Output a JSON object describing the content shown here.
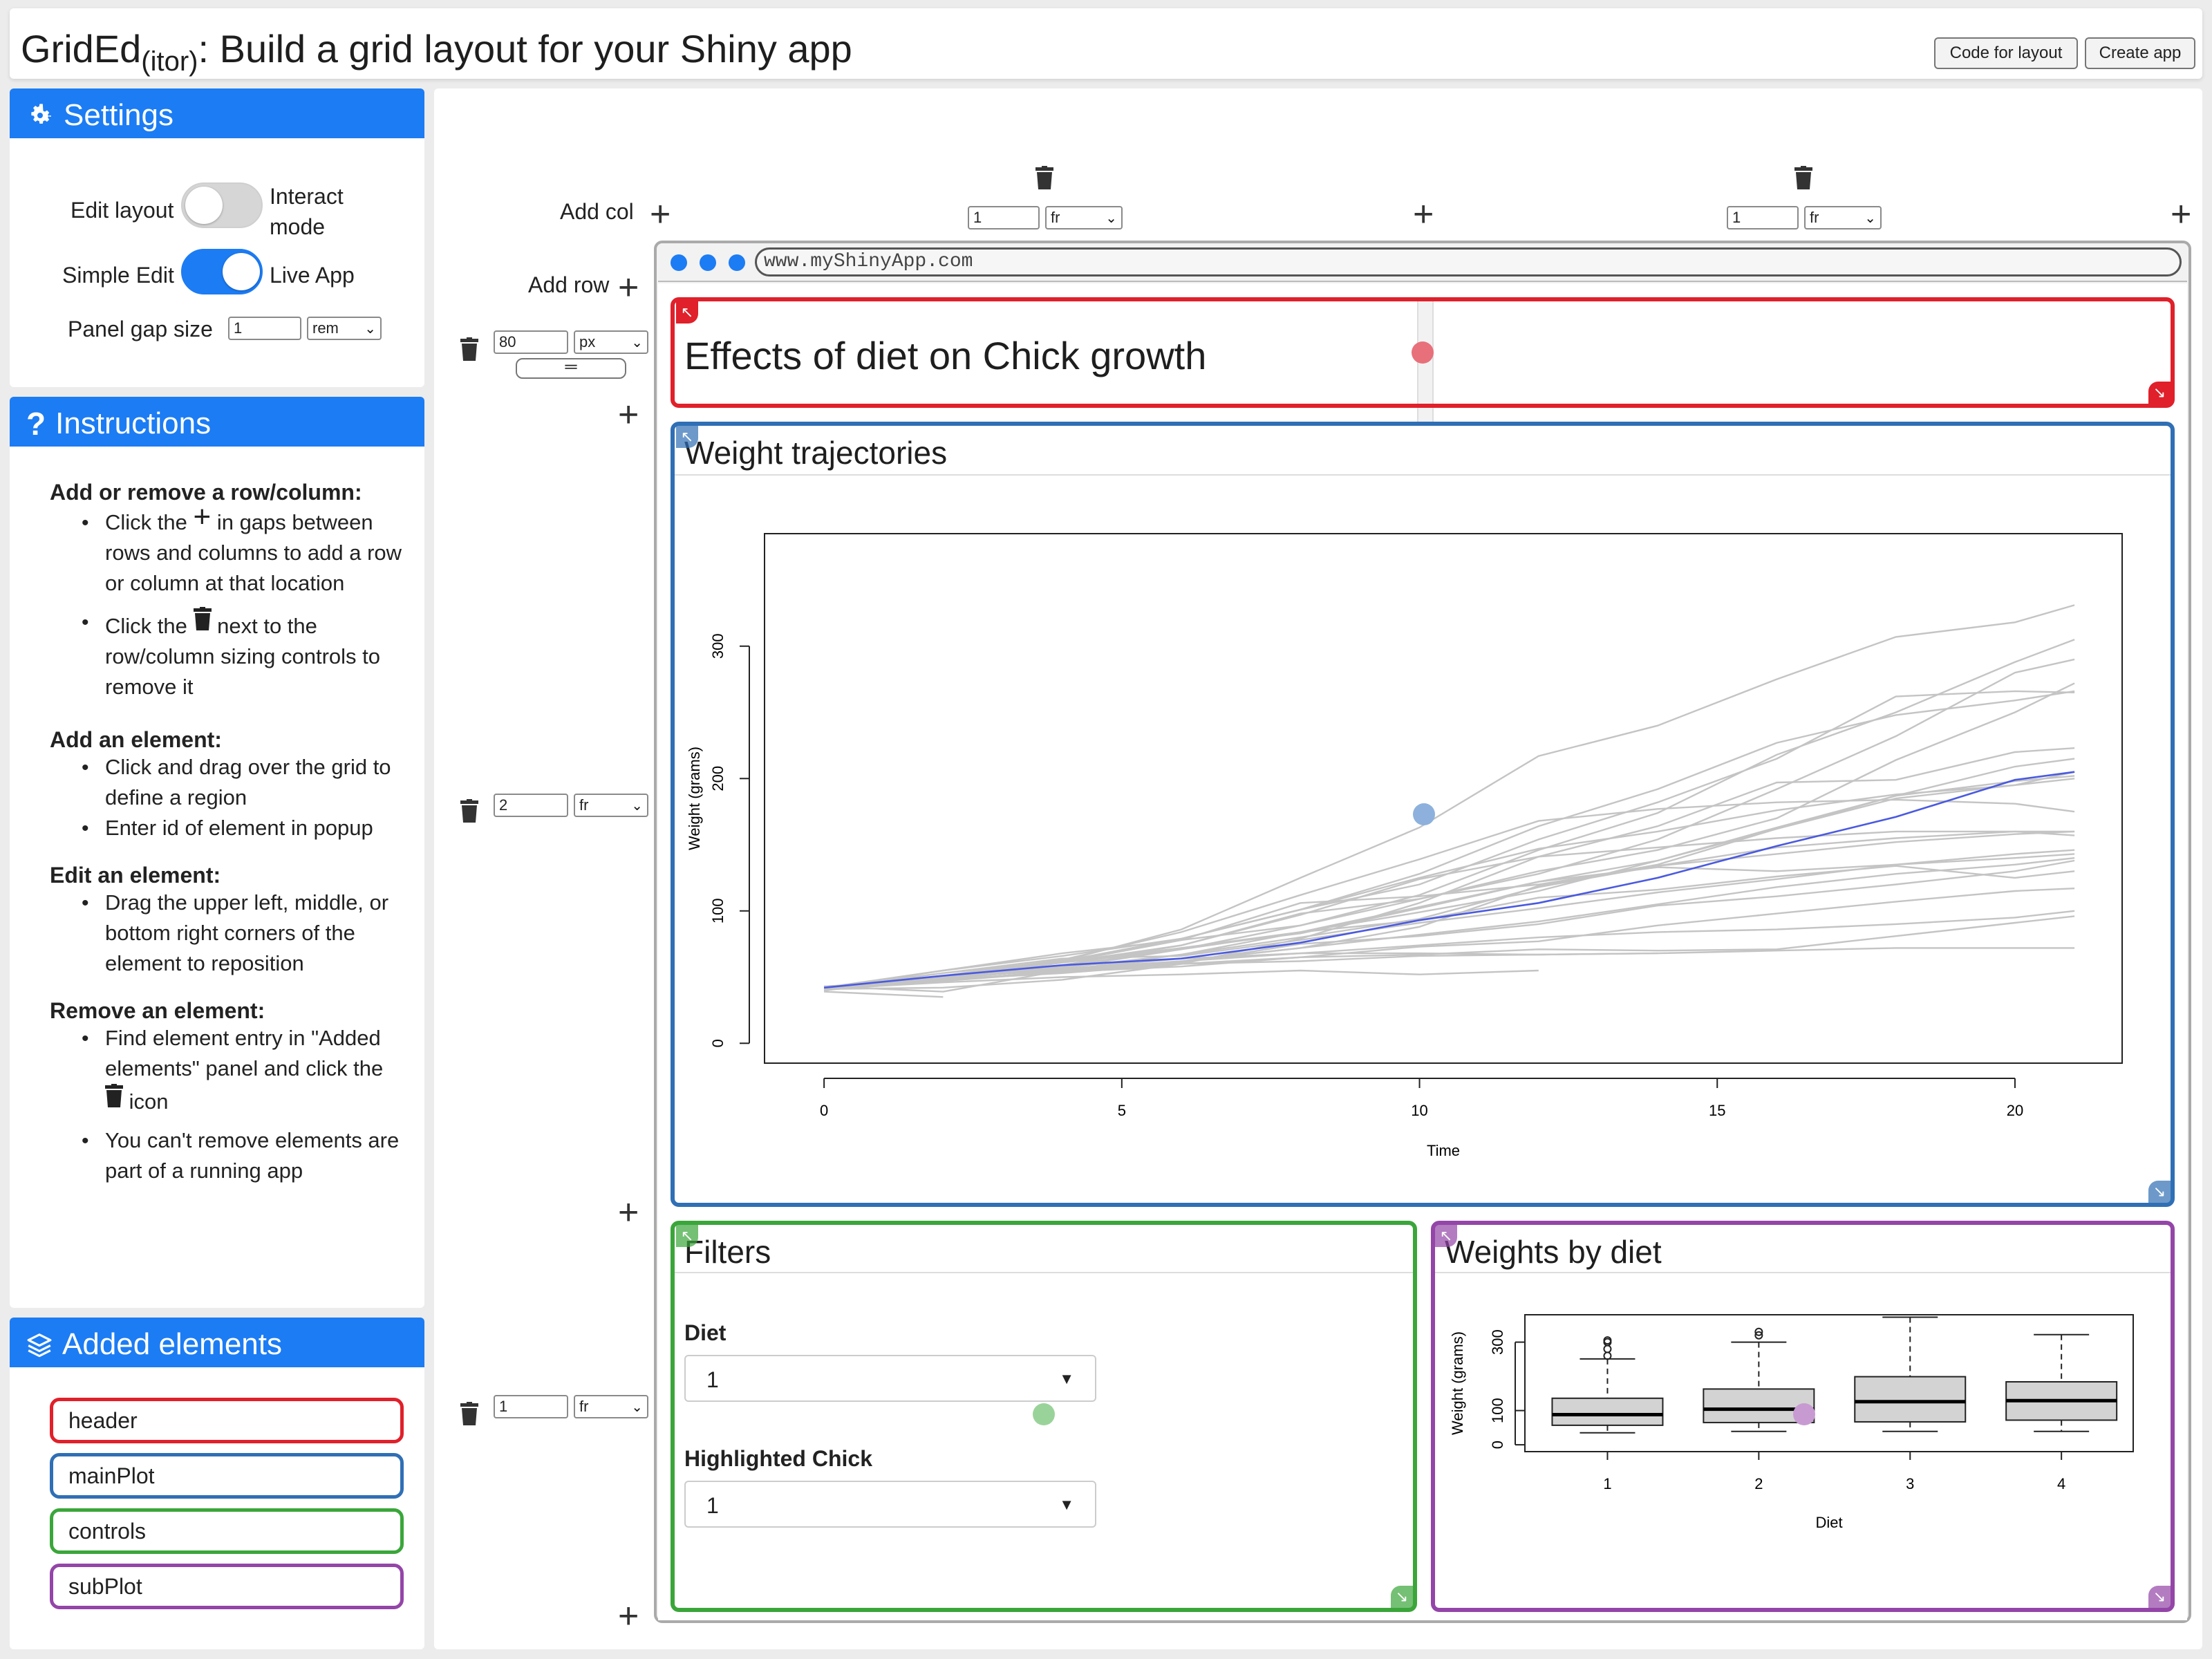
{
  "header": {
    "title_main": "GridEd",
    "title_sub": "(itor)",
    "title_rest": ": Build a grid layout for your Shiny app",
    "buttons": {
      "code": "Code for layout",
      "create": "Create app"
    }
  },
  "settings": {
    "title": "Settings",
    "edit_layout": "Edit layout",
    "interact_mode": "Interact mode",
    "simple_edit": "Simple Edit",
    "live_app": "Live App",
    "panel_gap_label": "Panel gap size",
    "panel_gap_value": "1",
    "panel_gap_unit": "rem",
    "toggle_edit_on": false,
    "toggle_simple_on": true
  },
  "instructions": {
    "title": "Instructions",
    "s1_head": "Add or remove a row/column:",
    "s1_i1a": "Click the",
    "s1_i1b": "in gaps between rows and columns to add a row or column at that location",
    "s1_i2a": "Click the",
    "s1_i2b": "next to the row/column sizing controls to remove it",
    "s2_head": "Add an element:",
    "s2_i1": "Click and drag over the grid to define a region",
    "s2_i2": "Enter id of element in popup",
    "s3_head": "Edit an element:",
    "s3_i1": "Drag the upper left, middle, or bottom right corners of the element to reposition",
    "s4_head": "Remove an element:",
    "s4_i1a": "Find element entry in \"Added elements\" panel and click the",
    "s4_i1b": "icon",
    "s4_i2": "You can't remove elements are part of a running app"
  },
  "added": {
    "title": "Added elements",
    "items": [
      {
        "label": "header",
        "color": "#e0202a"
      },
      {
        "label": "mainPlot",
        "color": "#2f6fb5"
      },
      {
        "label": "controls",
        "color": "#3aa63a"
      },
      {
        "label": "subPlot",
        "color": "#9445a8"
      }
    ]
  },
  "grid": {
    "add_col": "Add col",
    "add_row": "Add row",
    "col1": {
      "value": "1",
      "unit": "fr"
    },
    "col2": {
      "value": "1",
      "unit": "fr"
    },
    "row1": {
      "value": "80",
      "unit": "px"
    },
    "row2": {
      "value": "2",
      "unit": "fr"
    },
    "row3": {
      "value": "1",
      "unit": "fr"
    },
    "url": "www.myShinyApp.com"
  },
  "panels": {
    "header_title": "Effects of diet on Chick growth",
    "main_title": "Weight trajectories",
    "controls_title": "Filters",
    "sub_title": "Weights by diet",
    "diet_label": "Diet",
    "diet_value": "1",
    "chick_label": "Highlighted Chick",
    "chick_value": "1"
  },
  "colors": {
    "accent": "#1c7cf4",
    "header": "#e0202a",
    "main": "#2f6fb5",
    "controls": "#3aa63a",
    "sub": "#9445a8",
    "highlight": "#4a5ae0"
  },
  "chart_data": [
    {
      "type": "line",
      "title": "",
      "xlabel": "Time",
      "ylabel": "Weight (grams)",
      "xticks": [
        0,
        5,
        10,
        15,
        20
      ],
      "yticks": [
        0,
        100,
        200,
        300
      ],
      "xlim": [
        -1,
        21.8
      ],
      "ylim": [
        -15,
        385
      ],
      "series": [
        {
          "x": [
            0,
            2,
            4,
            6,
            8,
            10,
            12,
            14,
            16,
            18,
            20,
            21
          ],
          "y": [
            42,
            51,
            59,
            64,
            76,
            93,
            106,
            125,
            149,
            171,
            199,
            205
          ],
          "highlight": true
        },
        {
          "x": [
            0,
            2,
            4,
            6,
            8,
            10,
            12,
            14,
            16,
            18,
            20,
            21
          ],
          "y": [
            40,
            49,
            58,
            72,
            84,
            103,
            122,
            138,
            162,
            187,
            209,
            215
          ]
        },
        {
          "x": [
            0,
            2,
            4,
            6,
            8,
            10,
            12,
            14,
            16,
            18,
            20,
            21
          ],
          "y": [
            43,
            39,
            55,
            67,
            84,
            99,
            115,
            138,
            163,
            187,
            198,
            202
          ]
        },
        {
          "x": [
            0,
            2,
            4,
            6,
            8,
            10,
            12,
            14,
            16,
            18,
            20,
            21
          ],
          "y": [
            42,
            49,
            61,
            74,
            98,
            109,
            128,
            154,
            192,
            232,
            280,
            290
          ]
        },
        {
          "x": [
            0,
            2,
            4,
            6,
            8,
            10,
            12,
            14,
            16,
            18,
            20,
            21
          ],
          "y": [
            41,
            42,
            48,
            60,
            79,
            106,
            141,
            164,
            197,
            199,
            220,
            223
          ]
        },
        {
          "x": [
            0,
            2,
            4,
            6,
            8,
            10,
            12,
            14,
            16,
            18,
            20,
            21
          ],
          "y": [
            41,
            49,
            59,
            74,
            97,
            124,
            141,
            148,
            155,
            160,
            160,
            157
          ]
        },
        {
          "x": [
            0,
            2,
            4,
            6,
            8,
            10,
            12,
            14,
            16,
            18,
            20,
            21
          ],
          "y": [
            41,
            49,
            57,
            71,
            89,
            112,
            146,
            174,
            218,
            250,
            288,
            305
          ]
        },
        {
          "x": [
            0,
            2,
            4,
            6,
            8,
            10,
            12,
            14,
            16,
            18,
            20,
            21
          ],
          "y": [
            42,
            50,
            61,
            71,
            84,
            93,
            110,
            116,
            126,
            134,
            125,
            130
          ]
        },
        {
          "x": [
            0,
            2,
            4,
            6,
            8,
            10,
            12,
            14,
            16,
            18,
            20,
            21
          ],
          "y": [
            41,
            55,
            66,
            79,
            101,
            120,
            154,
            182,
            215,
            262,
            266,
            265
          ]
        },
        {
          "x": [
            0,
            2,
            4,
            6,
            8,
            10,
            12,
            14,
            16,
            18,
            20,
            21
          ],
          "y": [
            41,
            47,
            54,
            58,
            65,
            73,
            77,
            89,
            98,
            107,
            115,
            117
          ]
        },
        {
          "x": [
            0,
            2,
            4,
            6,
            8,
            10,
            12,
            14,
            16,
            18,
            20,
            21
          ],
          "y": [
            42,
            51,
            63,
            84,
            112,
            139,
            168,
            177,
            182,
            184,
            181,
            175
          ]
        },
        {
          "x": [
            0,
            2,
            4,
            6,
            8,
            10,
            12,
            14,
            16,
            18,
            20,
            21
          ],
          "y": [
            41,
            49,
            56,
            62,
            72,
            88,
            119,
            135,
            162,
            185,
            195,
            205
          ]
        },
        {
          "x": [
            0,
            2,
            4,
            6,
            8,
            10,
            12,
            14,
            16,
            18,
            20,
            21
          ],
          "y": [
            41,
            48,
            53,
            60,
            65,
            67,
            71,
            70,
            71,
            81,
            91,
            96
          ]
        },
        {
          "x": [
            0,
            2,
            4,
            6,
            8,
            10,
            12,
            14,
            16,
            18,
            20,
            21
          ],
          "y": [
            41,
            49,
            62,
            79,
            101,
            128,
            164,
            192,
            227,
            248,
            259,
            266
          ]
        },
        {
          "x": [
            0,
            2,
            4,
            6,
            8,
            10,
            12,
            14,
            16,
            18,
            20,
            21
          ],
          "y": [
            41,
            49,
            56,
            64,
            68,
            68,
            67,
            68,
            70,
            72,
            72,
            72
          ]
        },
        {
          "x": [
            0,
            2,
            4,
            6,
            8,
            10,
            12,
            14,
            16,
            18,
            20,
            21
          ],
          "y": [
            42,
            55,
            68,
            78,
            106,
            111,
            120,
            134,
            148,
            155,
            160,
            160
          ]
        },
        {
          "x": [
            0,
            2,
            4,
            6,
            8,
            10,
            12,
            14,
            16,
            18,
            20,
            21
          ],
          "y": [
            42,
            48,
            54,
            61,
            75,
            81,
            90,
            104,
            111,
            120,
            130,
            138
          ]
        },
        {
          "x": [
            0,
            2,
            4,
            6,
            8,
            10,
            12,
            14,
            16,
            18,
            20,
            21
          ],
          "y": [
            40,
            50,
            62,
            86,
            125,
            163,
            217,
            240,
            275,
            307,
            318,
            331
          ]
        },
        {
          "x": [
            0,
            2,
            4,
            6,
            8,
            10,
            12,
            14,
            16,
            18,
            20,
            21
          ],
          "y": [
            41,
            53,
            62,
            79,
            101,
            125,
            147,
            160,
            176,
            188,
            195,
            200
          ]
        },
        {
          "x": [
            0,
            2,
            4,
            6,
            8,
            10,
            12,
            14,
            16,
            18,
            20,
            21
          ],
          "y": [
            42,
            50,
            61,
            78,
            89,
            109,
            130,
            146,
            170,
            214,
            250,
            272
          ]
        },
        {
          "x": [
            0,
            2,
            4,
            6,
            8,
            10,
            12,
            14,
            16,
            18,
            20,
            21
          ],
          "y": [
            42,
            53,
            64,
            66,
            78,
            91,
            102,
            114,
            124,
            135,
            143,
            146
          ]
        },
        {
          "x": [
            0,
            2,
            4,
            6,
            8,
            10,
            12,
            14,
            16,
            18,
            20,
            21
          ],
          "y": [
            41,
            49,
            57,
            67,
            80,
            94,
            118,
            134,
            143,
            152,
            158,
            160
          ]
        },
        {
          "x": [
            0,
            2,
            4,
            6,
            8,
            10,
            12,
            14,
            16,
            18,
            20,
            21
          ],
          "y": [
            42,
            49,
            61,
            72,
            83,
            102,
            122,
            133,
            130,
            135,
            140,
            143
          ]
        },
        {
          "x": [
            0,
            2,
            4,
            6,
            8,
            10,
            12,
            14,
            16,
            18,
            20,
            21
          ],
          "y": [
            41,
            47,
            55,
            62,
            68,
            74,
            80,
            84,
            86,
            90,
            95,
            100
          ]
        },
        {
          "x": [
            0,
            2,
            4,
            6,
            8,
            10,
            12
          ],
          "y": [
            41,
            46,
            50,
            52,
            55,
            52,
            55
          ]
        },
        {
          "x": [
            0,
            2,
            4,
            6,
            8,
            10,
            12,
            14
          ],
          "y": [
            42,
            50,
            55,
            60,
            62,
            66,
            67,
            68
          ]
        },
        {
          "x": [
            0,
            2
          ],
          "y": [
            39,
            35
          ]
        },
        {
          "x": [
            0,
            2,
            4,
            6,
            8,
            10,
            12,
            14,
            16,
            18,
            20,
            21
          ],
          "y": [
            43,
            48,
            54,
            62,
            72,
            82,
            92,
            105,
            118,
            128,
            135,
            140
          ]
        }
      ]
    },
    {
      "type": "box",
      "title": "",
      "xlabel": "Diet",
      "ylabel": "Weight (grams)",
      "categories": [
        "1",
        "2",
        "3",
        "4"
      ],
      "yticks": [
        0,
        100,
        300
      ],
      "ylim": [
        -20,
        380
      ],
      "boxes": [
        {
          "low": 35,
          "q1": 57,
          "median": 88,
          "q3": 136,
          "high": 251,
          "outliers": [
            260,
            280,
            300,
            305
          ]
        },
        {
          "low": 39,
          "q1": 65,
          "median": 104,
          "q3": 163,
          "high": 300,
          "outliers": [
            320,
            330
          ]
        },
        {
          "low": 39,
          "q1": 67,
          "median": 126,
          "q3": 199,
          "high": 373,
          "outliers": []
        },
        {
          "low": 39,
          "q1": 72,
          "median": 129,
          "q3": 184,
          "high": 322,
          "outliers": []
        }
      ]
    }
  ]
}
